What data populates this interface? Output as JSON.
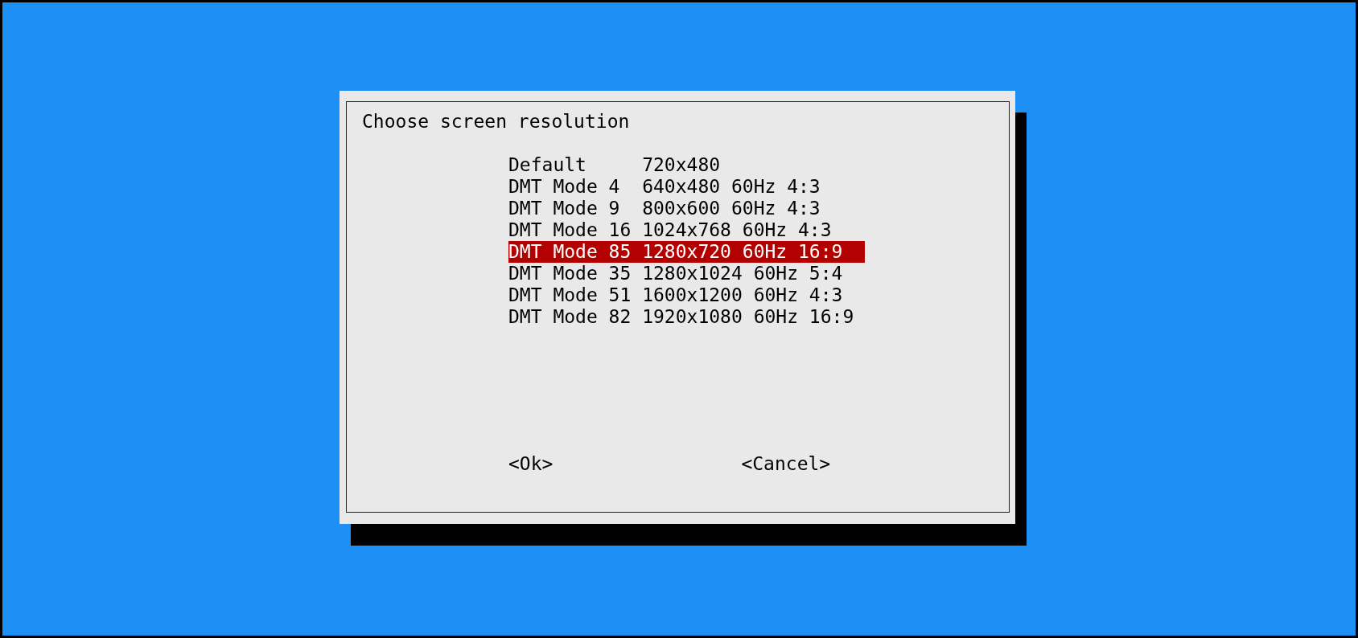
{
  "dialog": {
    "title": "Choose screen resolution",
    "items": [
      {
        "label": "Default     720x480",
        "selected": false
      },
      {
        "label": "DMT Mode 4  640x480 60Hz 4:3",
        "selected": false
      },
      {
        "label": "DMT Mode 9  800x600 60Hz 4:3",
        "selected": false
      },
      {
        "label": "DMT Mode 16 1024x768 60Hz 4:3",
        "selected": false
      },
      {
        "label": "DMT Mode 85 1280x720 60Hz 16:9",
        "selected": true
      },
      {
        "label": "DMT Mode 35 1280x1024 60Hz 5:4",
        "selected": false
      },
      {
        "label": "DMT Mode 51 1600x1200 60Hz 4:3",
        "selected": false
      },
      {
        "label": "DMT Mode 82 1920x1080 60Hz 16:9",
        "selected": false
      }
    ],
    "buttons": [
      "<Ok>",
      "<Cancel>"
    ]
  }
}
